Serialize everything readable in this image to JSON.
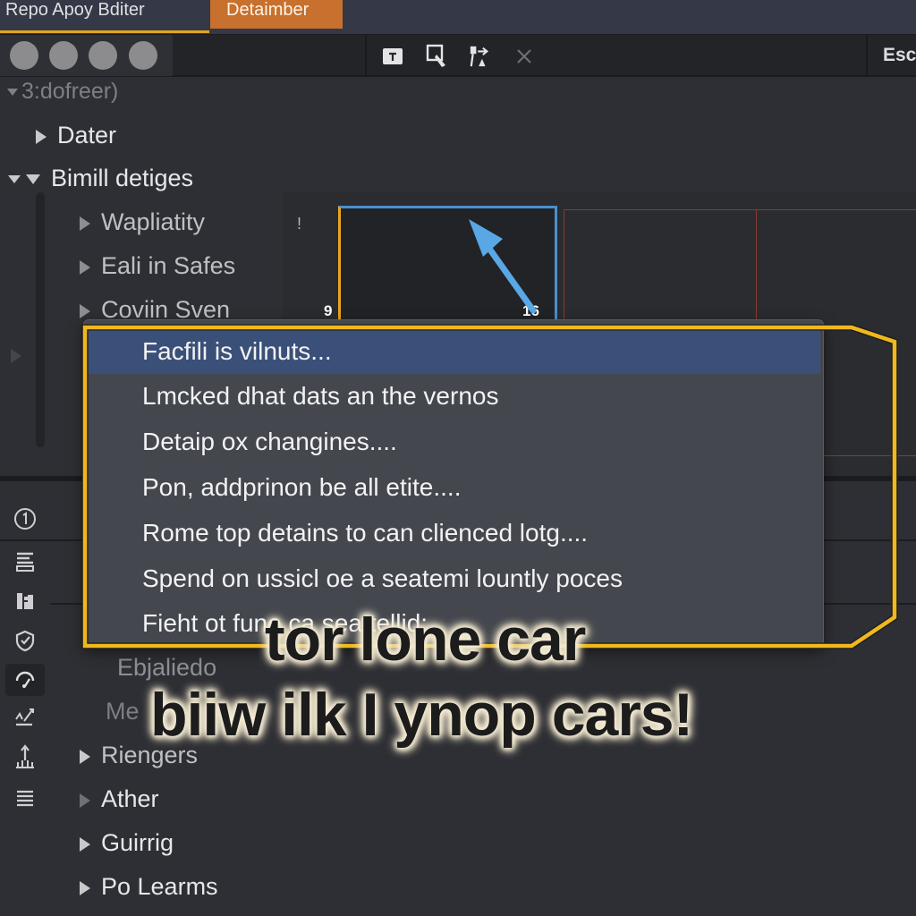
{
  "tabs": [
    {
      "label": "Repo  Apoy  Bditer",
      "active": false
    },
    {
      "label": "Detaimber",
      "active": true
    }
  ],
  "toolbar": {
    "window_dots": 4,
    "tools": [
      {
        "icon": "text-tool-icon"
      },
      {
        "icon": "select-pointer-icon"
      },
      {
        "icon": "transform-icon"
      },
      {
        "icon": "close-icon"
      }
    ],
    "right_label": "Esc"
  },
  "tree": {
    "root": "3:dofreer)",
    "items": [
      {
        "label": "Dater",
        "state": "collapsed",
        "level": 1
      },
      {
        "label": "Bimill detiges",
        "state": "expanded",
        "level": 1
      },
      {
        "label": "Wapliatity",
        "state": "collapsed",
        "level": 2
      },
      {
        "label": "Eali in Safes",
        "state": "collapsed",
        "level": 2
      },
      {
        "label": "Coviin Sven",
        "state": "collapsed",
        "level": 2
      }
    ],
    "lower_items": [
      {
        "label": "Ebjaliedo",
        "state": "none"
      },
      {
        "label": "Me",
        "state": "none"
      },
      {
        "label": "Riengers",
        "state": "collapsed"
      },
      {
        "label": "Ather",
        "state": "collapsed"
      },
      {
        "label": "Guirrig",
        "state": "collapsed"
      },
      {
        "label": "Po Learms",
        "state": "collapsed"
      }
    ]
  },
  "canvas": {
    "marker": "!",
    "selected_frame_labels": {
      "left": "9",
      "right": "16"
    }
  },
  "rail_icons": [
    {
      "name": "info-icon",
      "active": false
    },
    {
      "name": "layout-icon",
      "active": false
    },
    {
      "name": "components-icon",
      "active": false
    },
    {
      "name": "shield-check-icon",
      "active": false
    },
    {
      "name": "gauge-icon",
      "active": true
    },
    {
      "name": "edit-signature-icon",
      "active": false
    },
    {
      "name": "chart-upload-icon",
      "active": false
    },
    {
      "name": "menu-icon",
      "active": false
    }
  ],
  "context_menu": {
    "items": [
      {
        "label": "Facfili is vilnuts...",
        "highlighted": true
      },
      {
        "label": "Lmcked dhat dats an the vernos",
        "highlighted": false
      },
      {
        "label": "Detaip ox changines....",
        "highlighted": false
      },
      {
        "label": "Pon, addprinon be all etite....",
        "highlighted": false
      },
      {
        "label": "Rome top detains to can clienced lotg....",
        "highlighted": false
      },
      {
        "label": "Spend on ussicl oe a seatemi lountly poces",
        "highlighted": false
      },
      {
        "label": "Fieht ot fune ca seattellid:",
        "highlighted": false
      }
    ]
  },
  "caption": {
    "line1": "tor lone car",
    "line2": "biiw ilk I ynop cars!"
  },
  "colors": {
    "accent_orange": "#c8702e",
    "highlight_yellow": "#f0b81e",
    "selection_blue": "#4a90d0",
    "menu_highlight": "#3b5078",
    "guide_red": "#8a3b32"
  }
}
